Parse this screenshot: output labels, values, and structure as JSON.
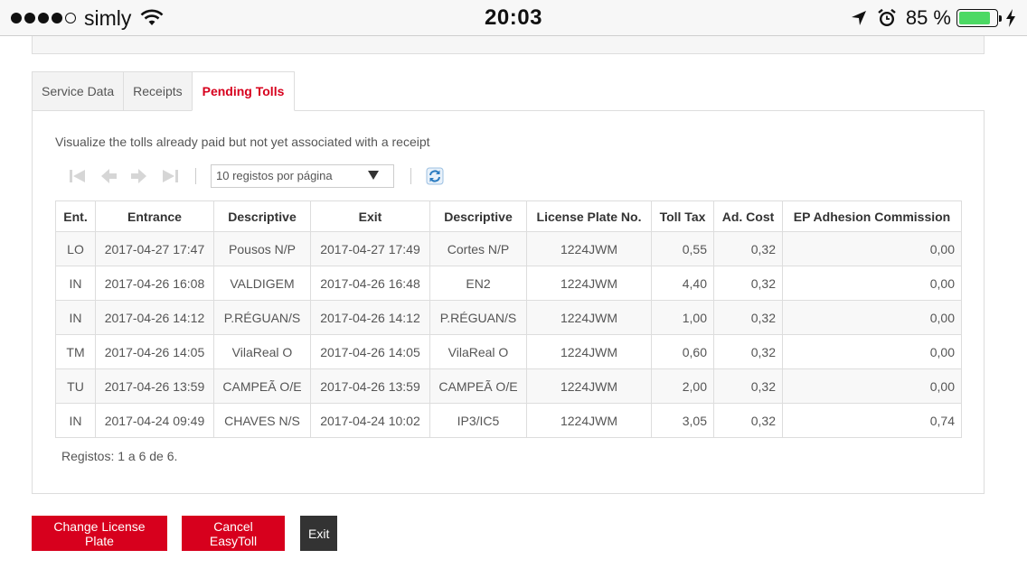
{
  "status_bar": {
    "carrier": "simly",
    "time": "20:03",
    "battery_percent": "85 %",
    "battery_level": 0.85,
    "signal_bars_filled": 4,
    "signal_bars_total": 5,
    "battery_color": "#4cd964"
  },
  "tabs": [
    {
      "label": "Service Data",
      "active": false
    },
    {
      "label": "Receipts",
      "active": false
    },
    {
      "label": "Pending Tolls",
      "active": true
    }
  ],
  "pending_tolls": {
    "description": "Visualize the tolls already paid but not yet associated with a receipt",
    "pager": {
      "per_page_selected": "10 registos por página",
      "icons": [
        "first-page-icon",
        "prev-page-icon",
        "next-page-icon",
        "last-page-icon",
        "refresh-icon"
      ]
    },
    "columns": [
      "Ent.",
      "Entrance",
      "Descriptive",
      "Exit",
      "Descriptive",
      "License Plate No.",
      "Toll Tax",
      "Ad. Cost",
      "EP Adhesion Commission"
    ],
    "rows": [
      [
        "LO",
        "2017-04-27 17:47",
        "Pousos N/P",
        "2017-04-27 17:49",
        "Cortes N/P",
        "1224JWM",
        "0,55",
        "0,32",
        "0,00"
      ],
      [
        "IN",
        "2017-04-26 16:08",
        "VALDIGEM",
        "2017-04-26 16:48",
        "EN2",
        "1224JWM",
        "4,40",
        "0,32",
        "0,00"
      ],
      [
        "IN",
        "2017-04-26 14:12",
        "P.RÉGUAN/S",
        "2017-04-26 14:12",
        "P.RÉGUAN/S",
        "1224JWM",
        "1,00",
        "0,32",
        "0,00"
      ],
      [
        "TM",
        "2017-04-26 14:05",
        "VilaReal O",
        "2017-04-26 14:05",
        "VilaReal O",
        "1224JWM",
        "0,60",
        "0,32",
        "0,00"
      ],
      [
        "TU",
        "2017-04-26 13:59",
        "CAMPEÃ O/E",
        "2017-04-26 13:59",
        "CAMPEÃ O/E",
        "1224JWM",
        "2,00",
        "0,32",
        "0,00"
      ],
      [
        "IN",
        "2017-04-24 09:49",
        "CHAVES N/S",
        "2017-04-24 10:02",
        "IP3/IC5",
        "1224JWM",
        "3,05",
        "0,32",
        "0,74"
      ]
    ],
    "records_text": "Registos: 1 a 6 de 6."
  },
  "actions": {
    "change_plate": "Change License Plate",
    "cancel_easytoll": "Cancel EasyToll",
    "exit": "Exit"
  },
  "colors": {
    "accent": "#d7001d",
    "dark_button": "#333333",
    "refresh_icon": "#2a7bc0"
  }
}
